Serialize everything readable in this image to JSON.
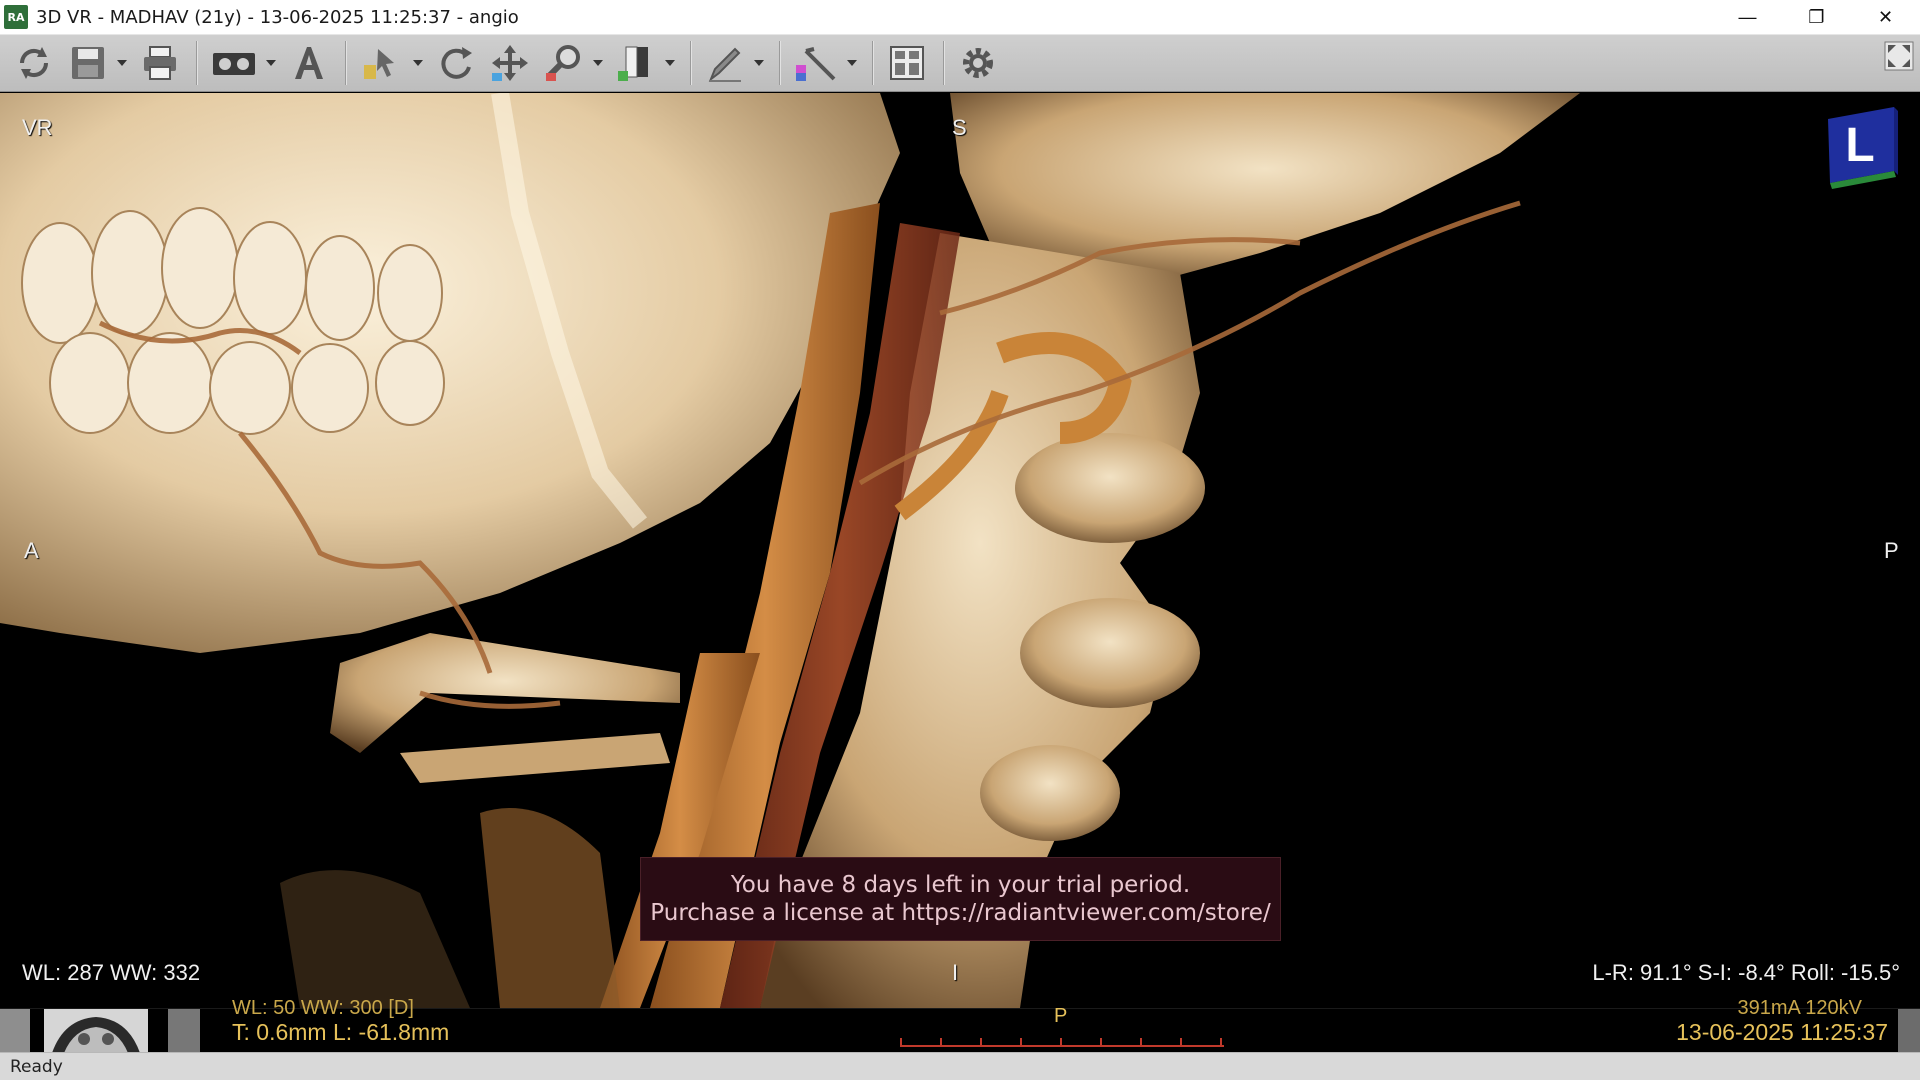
{
  "window": {
    "app_icon_text": "RA",
    "title": "3D VR - MADHAV (21y) - 13-06-2025 11:25:37 - angio",
    "minimize_glyph": "—",
    "restore_glyph": "❐",
    "close_glyph": "✕"
  },
  "toolbar": {
    "buttons": [
      {
        "name": "refresh-icon"
      },
      {
        "name": "save-icon"
      },
      {
        "name": "print-icon"
      },
      {
        "name": "cine-icon"
      },
      {
        "name": "annotation-text-icon"
      },
      {
        "name": "pointer-tool-icon"
      },
      {
        "name": "rotate-icon"
      },
      {
        "name": "pan-icon"
      },
      {
        "name": "zoom-icon"
      },
      {
        "name": "window-level-icon"
      },
      {
        "name": "measure-pen-icon"
      },
      {
        "name": "angle-tool-icon"
      },
      {
        "name": "layout-grid-icon"
      },
      {
        "name": "settings-gear-icon"
      },
      {
        "name": "fullscreen-icon"
      }
    ]
  },
  "viewport": {
    "mode_label": "VR",
    "orient_top": "S",
    "orient_left": "A",
    "orient_right": "P",
    "orient_cube_letter": "L",
    "window_level": "WL: 287 WW: 332",
    "rotation": "L-R: 91.1° S-I: -8.4° Roll: -15.5°",
    "cursor_glyph": "I",
    "trial_line1": "You have 8 days left in your trial period.",
    "trial_line2": "Purchase a license at https://radiantviewer.com/store/"
  },
  "thumbnail_strip": {
    "cut_top_left": "WL: 50 WW: 300 [D]",
    "slice_info": "T: 0.6mm L: -61.8mm",
    "orient_marker": "P",
    "cut_top_right": "391mA 120kV",
    "datetime": "13-06-2025 11:25:37"
  },
  "status": {
    "text": "Ready"
  },
  "colors": {
    "overlay_text": "#f0f0f0",
    "strip_text": "#e6c15a",
    "trial_bg": "#2a0c14",
    "cube_blue": "#1f2f9e"
  }
}
